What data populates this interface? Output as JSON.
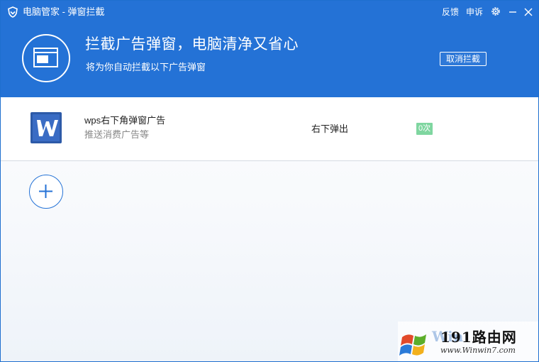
{
  "titlebar": {
    "title": "电脑管家 - 弹窗拦截",
    "feedback": "反馈",
    "appeal": "申诉"
  },
  "hero": {
    "title": "拦截广告弹窗，电脑清净又省心",
    "subtitle": "将为你自动拦截以下广告弹窗",
    "cancel_label": "取消拦截"
  },
  "items": [
    {
      "name": "wps右下角弹窗广告",
      "desc": "推送消费广告等",
      "position": "右下弹出",
      "count": "0次"
    }
  ],
  "watermark": {
    "brand_text": "191路由网",
    "site_text": "www.Winwin7.com"
  },
  "colors": {
    "accent": "#2472d6",
    "count_badge": "#7fd6a0"
  }
}
